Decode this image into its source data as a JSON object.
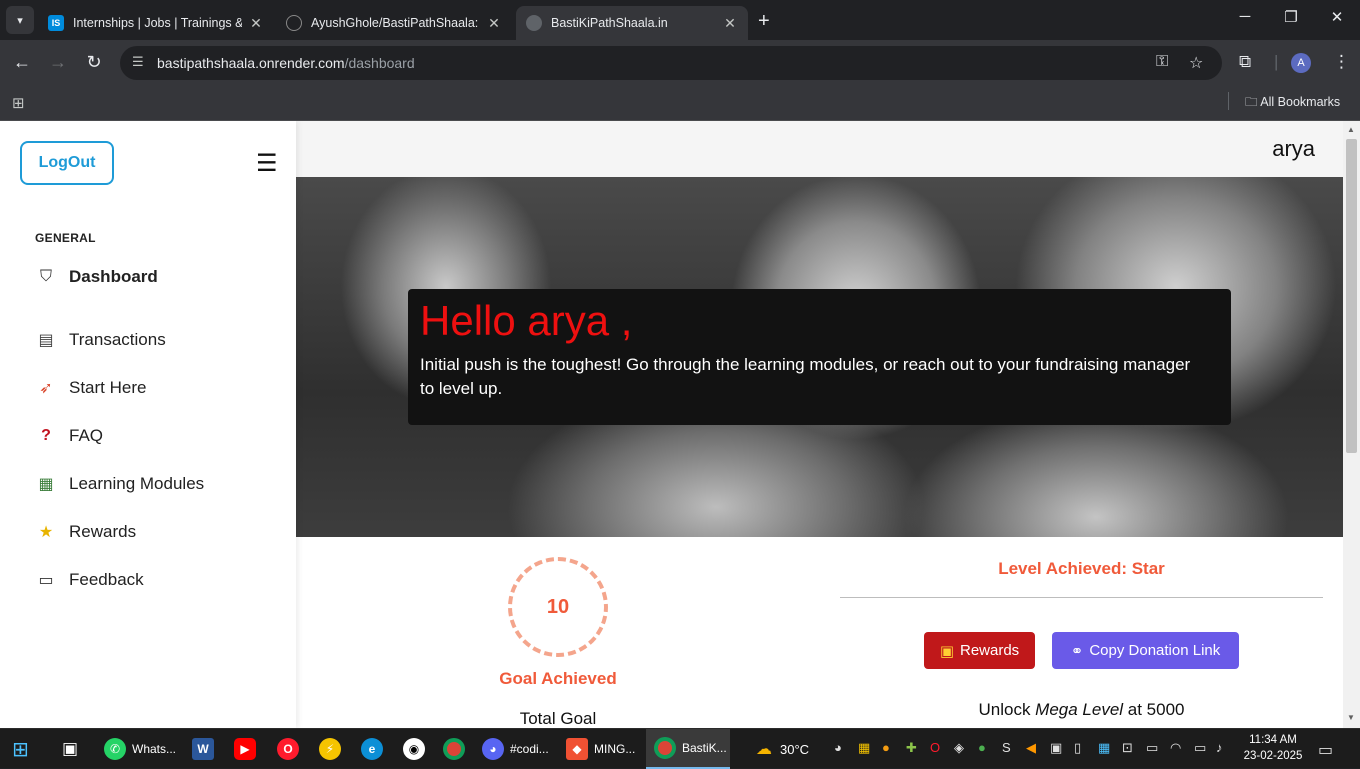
{
  "browser": {
    "tabs": [
      {
        "title": "Internships | Jobs | Trainings & Online Courses",
        "favicon": "IS"
      },
      {
        "title": "AyushGhole/BastiPathShaala: Online",
        "favicon": "github"
      },
      {
        "title": "BastiKiPathShaala.in",
        "favicon": "globe"
      }
    ],
    "url_domain": "bastipathshaala.onrender.com",
    "url_path": "/dashboard",
    "profile_initial": "A",
    "bookmarks_label": "All Bookmarks"
  },
  "sidebar": {
    "logout_label": "LogOut",
    "section_label": "GENERAL",
    "items": [
      {
        "label": "Dashboard",
        "icon": "shield-icon"
      },
      {
        "label": "Transactions",
        "icon": "notebook-icon"
      },
      {
        "label": "Start Here",
        "icon": "rocket-icon"
      },
      {
        "label": "FAQ",
        "icon": "question-icon"
      },
      {
        "label": "Learning Modules",
        "icon": "books-icon"
      },
      {
        "label": "Rewards",
        "icon": "star-icon"
      },
      {
        "label": "Feedback",
        "icon": "chat-icon"
      }
    ]
  },
  "header": {
    "username": "arya"
  },
  "hero": {
    "greeting": "Hello arya ,",
    "message": "Initial push is the toughest! Go through the learning modules, or reach out to your fundraising manager to level up."
  },
  "stats": {
    "goal_value": "10",
    "goal_label": "Goal Achieved",
    "total_goal_label": "Total Goal",
    "level_label": "Level Achieved: Star",
    "rewards_button": "Rewards",
    "copy_link_button": "Copy Donation Link",
    "unlock_prefix": "Unlock ",
    "unlock_level": "Mega Level",
    "unlock_suffix": " at 5000"
  },
  "taskbar": {
    "apps": [
      {
        "label": "Whats...",
        "icon": "whatsapp-icon"
      },
      {
        "label": "",
        "icon": "word-icon"
      },
      {
        "label": "",
        "icon": "youtube-icon"
      },
      {
        "label": "",
        "icon": "opera-icon"
      },
      {
        "label": "",
        "icon": "app-icon"
      },
      {
        "label": "",
        "icon": "edge-icon"
      },
      {
        "label": "",
        "icon": "github-icon"
      },
      {
        "label": "",
        "icon": "chrome-icon"
      },
      {
        "label": "#codi...",
        "icon": "discord-icon"
      },
      {
        "label": "MING...",
        "icon": "git-icon"
      },
      {
        "label": "BastiK...",
        "icon": "chrome-icon"
      }
    ],
    "weather": "30°C",
    "time": "11:34 AM",
    "date": "23-02-2025"
  },
  "colors": {
    "accent_blue": "#1e9bd7",
    "greeting_red": "#ee1010",
    "stat_orange": "#f05a3a",
    "rewards_red": "#c0181a",
    "copy_purple": "#6a5ae8"
  }
}
